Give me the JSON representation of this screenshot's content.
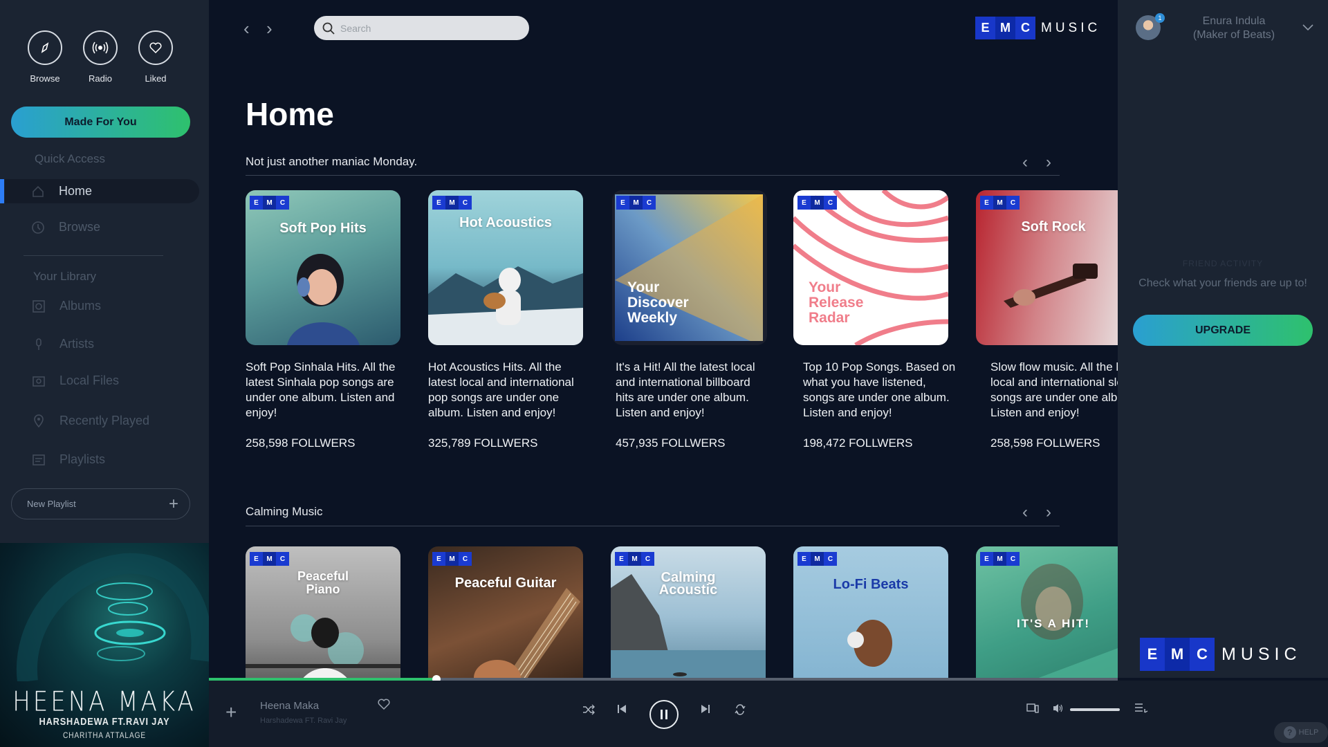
{
  "nav_top": [
    {
      "label": "Browse",
      "icon": "compass-icon"
    },
    {
      "label": "Radio",
      "icon": "radio-icon"
    },
    {
      "label": "Liked",
      "icon": "heart-icon"
    }
  ],
  "sidebar": {
    "made_for_you": "Made For You",
    "quick_access": "Quick Access",
    "quick_items": [
      {
        "label": "Home",
        "icon": "home-icon",
        "active": true
      },
      {
        "label": "Browse",
        "icon": "compass-icon",
        "active": false
      }
    ],
    "library_title": "Your Library",
    "library_items": [
      {
        "label": "Albums",
        "icon": "album-icon"
      },
      {
        "label": "Artists",
        "icon": "microphone-icon"
      },
      {
        "label": "Local Files",
        "icon": "files-icon"
      },
      {
        "label": "Recently Played",
        "icon": "location-icon"
      },
      {
        "label": "Playlists",
        "icon": "playlist-icon"
      }
    ],
    "new_playlist": "New Playlist"
  },
  "now_playing_art": {
    "title": "HEENA MAKA",
    "artists": "HARSHADEWA FT.RAVI JAY",
    "producer": "CHARITHA ATTALAGE"
  },
  "header": {
    "search_placeholder": "Search",
    "logo_letters": [
      "E",
      "M",
      "C"
    ],
    "logo_word": "MUSIC"
  },
  "main": {
    "title": "Home",
    "sections": [
      {
        "title": "Not just another maniac Monday.",
        "cards": [
          {
            "cover_title": "Soft Pop Hits",
            "description": "Soft Pop Sinhala Hits. All the latest Sinhala pop songs are under one album. Listen and enjoy!",
            "followers": "258,598 FOLLWERS"
          },
          {
            "cover_title": "Hot Acoustics",
            "description": "Hot Acoustics Hits. All the latest local and international pop songs are under one album. Listen and enjoy!",
            "followers": "325,789 FOLLWERS"
          },
          {
            "cover_title": "Your Discover Weekly",
            "description": "It's a Hit! All the latest local and international billboard hits  are under one album. Listen and enjoy!",
            "followers": "457,935 FOLLWERS"
          },
          {
            "cover_title": "Your Release Radar",
            "description": "Top 10 Pop Songs. Based on what you have listened, songs are under one album. Listen and enjoy!",
            "followers": "198,472 FOLLWERS"
          },
          {
            "cover_title": "Soft Rock",
            "description": "Slow flow music. All the latest local and international slow songs are under one album. Listen and enjoy!",
            "followers": "258,598 FOLLWERS"
          }
        ]
      },
      {
        "title": "Calming Music",
        "cards": [
          {
            "cover_title": "Peaceful Piano"
          },
          {
            "cover_title": "Peaceful Guitar"
          },
          {
            "cover_title": "Calming Acoustic"
          },
          {
            "cover_title": "Lo-Fi Beats"
          },
          {
            "cover_title": "IT'S A HIT!"
          }
        ]
      }
    ]
  },
  "right_panel": {
    "user_name": "Enura Indula\n(Maker of Beats)",
    "notification_count": "1",
    "friend_activity_title": "FRIEND ACTIVITY",
    "friend_activity_text": "Check what your friends are up to!",
    "upgrade": "UPGRADE"
  },
  "player": {
    "song": "Heena Maka",
    "artist": "Harshadewa FT. Ravi Jay",
    "progress": 0.25,
    "volume": 1.0,
    "help": "HELP"
  },
  "colors": {
    "accent_gradient_start": "#2a9fd1",
    "accent_gradient_end": "#2ec16d",
    "logo_blue": "#1837c9",
    "background": "#0b1324",
    "sidebar": "#1b2432"
  }
}
